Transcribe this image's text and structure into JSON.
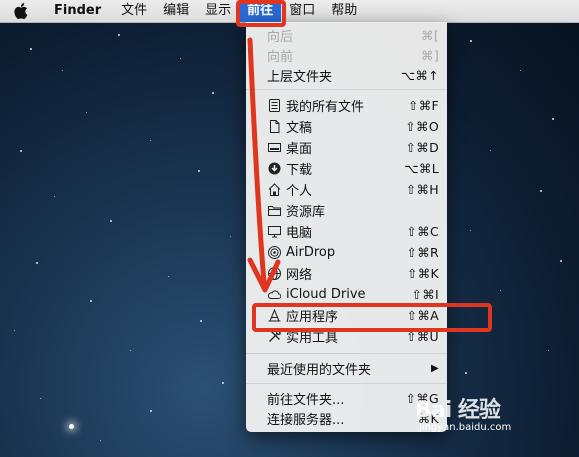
{
  "menubar": {
    "app": "Finder",
    "items": [
      "文件",
      "编辑",
      "显示",
      "前往",
      "窗口",
      "帮助"
    ],
    "active": "前往"
  },
  "menu": {
    "items": [
      {
        "label": "向后",
        "shortcut": "⌘[",
        "icon": "none",
        "disabled": true
      },
      {
        "label": "向前",
        "shortcut": "⌘]",
        "icon": "none",
        "disabled": true
      },
      {
        "label": "上层文件夹",
        "shortcut": "⌥⌘↑",
        "icon": "none",
        "disabled": false
      },
      {
        "label": "我的所有文件",
        "shortcut": "⇧⌘F",
        "icon": "all-files-icon"
      },
      {
        "label": "文稿",
        "shortcut": "⇧⌘O",
        "icon": "document-icon"
      },
      {
        "label": "桌面",
        "shortcut": "⇧⌘D",
        "icon": "desktop-icon"
      },
      {
        "label": "下载",
        "shortcut": "⌥⌘L",
        "icon": "download-icon"
      },
      {
        "label": "个人",
        "shortcut": "⇧⌘H",
        "icon": "home-icon"
      },
      {
        "label": "资源库",
        "shortcut": "",
        "icon": "folder-icon"
      },
      {
        "label": "电脑",
        "shortcut": "⇧⌘C",
        "icon": "computer-icon"
      },
      {
        "label": "AirDrop",
        "shortcut": "⇧⌘R",
        "icon": "airdrop-icon"
      },
      {
        "label": "网络",
        "shortcut": "⇧⌘K",
        "icon": "network-icon"
      },
      {
        "label": "iCloud Drive",
        "shortcut": "⇧⌘I",
        "icon": "cloud-icon"
      },
      {
        "label": "应用程序",
        "shortcut": "⇧⌘A",
        "icon": "applications-icon"
      },
      {
        "label": "实用工具",
        "shortcut": "⇧⌘U",
        "icon": "utilities-icon"
      },
      {
        "label": "最近使用的文件夹",
        "shortcut": "▶",
        "icon": "none"
      },
      {
        "label": "前往文件夹...",
        "shortcut": "⇧⌘G",
        "icon": "none"
      },
      {
        "label": "连接服务器...",
        "shortcut": "⌘K",
        "icon": "none"
      }
    ]
  },
  "watermark": {
    "logo": "Bai 经验",
    "url": "jingyan.baidu.com"
  },
  "colors": {
    "highlight": "#2a6ad6",
    "annotation": "#e0351f"
  }
}
